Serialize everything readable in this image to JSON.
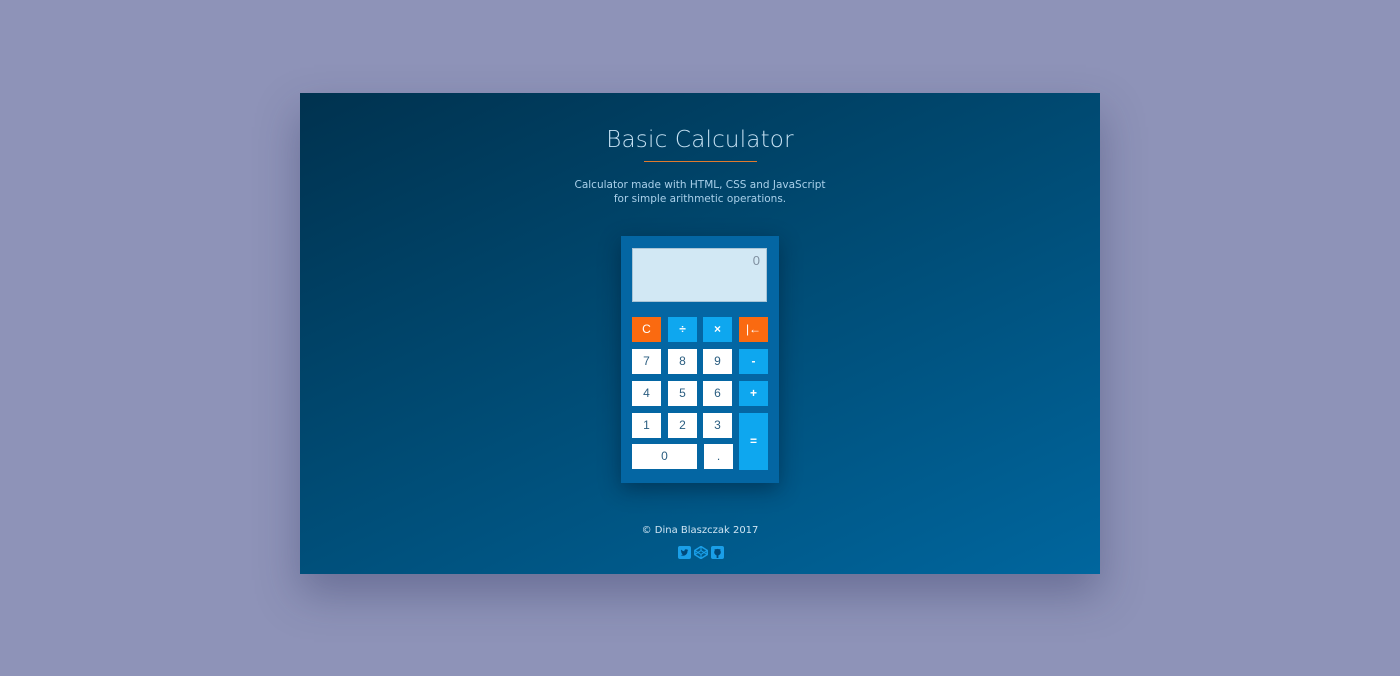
{
  "header": {
    "title": "Basic Calculator",
    "subtitle_line1": "Calculator made with HTML, CSS and JavaScript",
    "subtitle_line2": "for simple arithmetic operations."
  },
  "calculator": {
    "display_value": "0",
    "keys": {
      "clear": "C",
      "divide": "÷",
      "multiply": "×",
      "backspace": "|←",
      "seven": "7",
      "eight": "8",
      "nine": "9",
      "minus": "-",
      "four": "4",
      "five": "5",
      "six": "6",
      "plus": "+",
      "one": "1",
      "two": "2",
      "three": "3",
      "equals": "=",
      "zero": "0",
      "decimal": "."
    }
  },
  "footer": {
    "copyright": "© Dina Blaszczak 2017",
    "social_icons": [
      "twitter-icon",
      "codepen-icon",
      "github-icon"
    ]
  },
  "colors": {
    "page_background": "#8e93b8",
    "panel_dark": "#00324f",
    "panel_light": "#00669e",
    "calculator_body": "#0466a3",
    "display": "#d2e8f4",
    "operator_key": "#0ea7ef",
    "clear_key": "#fa6a10",
    "accent_underline": "#e07a2e",
    "social_icon": "#1a9fe8"
  }
}
